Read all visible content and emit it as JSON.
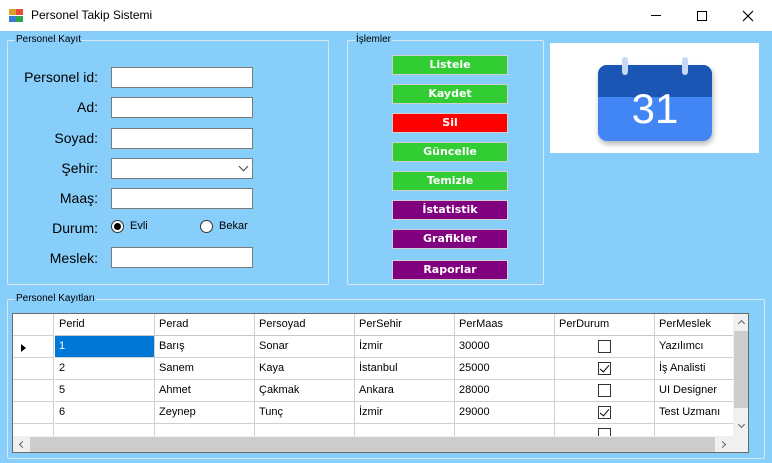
{
  "window": {
    "title": "Personel Takip Sistemi"
  },
  "kayit": {
    "legend": "Personel Kayıt",
    "labels": {
      "id": "Personel id:",
      "ad": "Ad:",
      "soyad": "Soyad:",
      "sehir": "Şehir:",
      "maas": "Maaş:",
      "durum": "Durum:",
      "meslek": "Meslek:"
    },
    "values": {
      "id": "",
      "ad": "",
      "soyad": "",
      "sehir": "",
      "maas": "",
      "meslek": ""
    },
    "durum_options": {
      "evli": "Evli",
      "bekar": "Bekar"
    },
    "durum_selected": "Evli"
  },
  "islemler": {
    "legend": "İşlemler",
    "buttons": {
      "listele": "Listele",
      "kaydet": "Kaydet",
      "sil": "Sil",
      "guncelle": "Güncelle",
      "temizle": "Temizle",
      "istatistik": "İstatistik",
      "grafikler": "Grafikler",
      "raporlar": "Raporlar"
    },
    "colors": {
      "green": "#32cd32",
      "red": "#ff0000",
      "purple": "#800080"
    }
  },
  "calendar_image": {
    "day": "31",
    "colors": {
      "top": "#1e56b5",
      "body": "#4285f4",
      "binding": "#c6d8f5",
      "text": "#ffffff"
    }
  },
  "kayitlar": {
    "legend": "Personel Kayıtları",
    "columns": [
      "Perid",
      "Perad",
      "Persoyad",
      "PerSehir",
      "PerMaas",
      "PerDurum",
      "PerMeslek"
    ],
    "rows": [
      {
        "id": "1",
        "ad": "Barış",
        "soyad": "Sonar",
        "sehir": "İzmir",
        "maas": "30000",
        "durum": false,
        "meslek": "Yazılımcı"
      },
      {
        "id": "2",
        "ad": "Sanem",
        "soyad": "Kaya",
        "sehir": "İstanbul",
        "maas": "25000",
        "durum": true,
        "meslek": "İş Analisti"
      },
      {
        "id": "5",
        "ad": "Ahmet",
        "soyad": "Çakmak",
        "sehir": "Ankara",
        "maas": "28000",
        "durum": false,
        "meslek": "UI Designer"
      },
      {
        "id": "6",
        "ad": "Zeynep",
        "soyad": "Tunç",
        "sehir": "İzmir",
        "maas": "29000",
        "durum": true,
        "meslek": "Test Uzmanı"
      }
    ],
    "selected_row": 0
  }
}
